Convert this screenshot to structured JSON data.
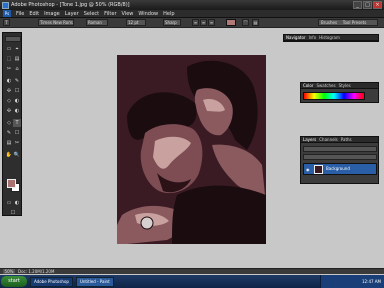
{
  "window": {
    "title": "Adobe Photoshop - [Tone 1.jpg @ 50% (RGB/8)]",
    "min": "_",
    "max": "□",
    "close": "×"
  },
  "menu": {
    "logo": "Ps",
    "items": [
      "File",
      "Edit",
      "Image",
      "Layer",
      "Select",
      "Filter",
      "View",
      "Window",
      "Help"
    ]
  },
  "options": {
    "tool_icon": "T",
    "font_family": "Times New Roman",
    "font_style": "Roman",
    "font_size": "12 pt",
    "antialias": "Sharp",
    "right_tabs": [
      "Brushes",
      "Tool Presets",
      "Layer Comps"
    ]
  },
  "tools": {
    "icons": [
      "▭",
      "⬚",
      "⌖",
      "✂",
      "⌂",
      "✎",
      "▤",
      "◐",
      "✣",
      "T",
      "◇",
      "☐",
      "✋",
      "🔍"
    ]
  },
  "panels": {
    "navigator": {
      "tabs": [
        "Navigator",
        "Info",
        "Histogram"
      ]
    },
    "color": {
      "tabs": [
        "Color",
        "Swatches",
        "Styles"
      ]
    },
    "layers": {
      "tabs": [
        "Layers",
        "Channels",
        "Paths"
      ],
      "layer_name": "Background",
      "eye": "◉"
    }
  },
  "status": {
    "zoom": "50%",
    "info": "Doc: 1.20M/1.20M"
  },
  "taskbar": {
    "start": "start",
    "tasks": [
      "Adobe Photoshop",
      "Untitled - Paint"
    ],
    "clock": "12:47 AM"
  }
}
